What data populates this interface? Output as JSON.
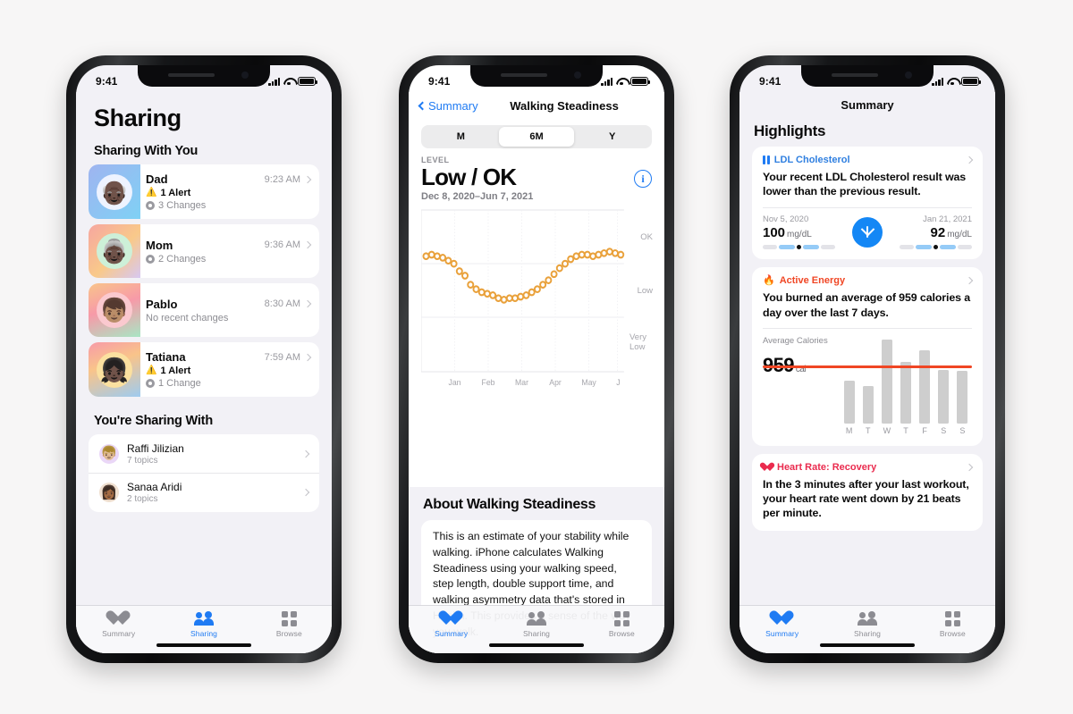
{
  "background_color": "#f7f6f6",
  "accent_blue": "#1f7bf3",
  "phones": {
    "sharing": {
      "status": {
        "time": "9:41",
        "signal_icon": "cellular-bars-icon",
        "wifi_icon": "wifi-icon",
        "battery_icon": "battery-icon"
      },
      "title": "Sharing",
      "section_with_you": "Sharing With You",
      "people": [
        {
          "name": "Dad",
          "time": "9:23 AM",
          "alert": "1 Alert",
          "changes": "3 Changes",
          "emoji": "👴🏿",
          "g1": "#9fb4f0",
          "g2": "#7fd1f5",
          "ring": "#eef3ff"
        },
        {
          "name": "Mom",
          "time": "9:36 AM",
          "alert": "",
          "changes": "2 Changes",
          "emoji": "👵🏿",
          "g1": "#f6a6a0",
          "g2": "#f9c98a",
          "ring": "#cdf0d8"
        },
        {
          "name": "Pablo",
          "time": "8:30 AM",
          "alert": "",
          "changes": "No recent changes",
          "emoji": "👦🏽",
          "g1": "#f9c48a",
          "g2": "#a8e6c4",
          "ring": "#fbc9cf"
        },
        {
          "name": "Tatiana",
          "time": "7:59 AM",
          "alert": "1 Alert",
          "changes": "1 Change",
          "emoji": "👧🏿",
          "g1": "#f79aa8",
          "g2": "#9ecbf0",
          "ring": "#fbe0a0"
        }
      ],
      "section_you_share": "You're Sharing With",
      "contacts": [
        {
          "name": "Raffi Jilizian",
          "topics": "7 topics",
          "emoji": "👦🏼",
          "bg": "#ead7f7"
        },
        {
          "name": "Sanaa Aridi",
          "topics": "2 topics",
          "emoji": "👩🏾",
          "bg": "#f0e0d0"
        }
      ],
      "tabs": [
        {
          "label": "Summary",
          "icon": "heart-icon",
          "active": false
        },
        {
          "label": "Sharing",
          "icon": "people-icon",
          "active": true
        },
        {
          "label": "Browse",
          "icon": "grid-icon",
          "active": false
        }
      ]
    },
    "walking": {
      "status": {
        "time": "9:41"
      },
      "back_label": "Summary",
      "nav_title": "Walking Steadiness",
      "segments": [
        {
          "label": "M",
          "selected": false
        },
        {
          "label": "6M",
          "selected": true
        },
        {
          "label": "Y",
          "selected": false
        }
      ],
      "level_label": "LEVEL",
      "level_value": "Low / OK",
      "date_range": "Dec 8, 2020–Jun 7, 2021",
      "info_icon": "info-circle-icon",
      "about_heading": "About Walking Steadiness",
      "about_text": "This is an estimate of your stability while walking. iPhone calculates Walking Steadiness using your walking speed, step length, double support time, and walking asymmetry data that's stored in Health. This provides a sense of the way you walk.",
      "tabs": [
        {
          "label": "Summary",
          "icon": "heart-icon",
          "active": true
        },
        {
          "label": "Sharing",
          "icon": "people-icon",
          "active": false
        },
        {
          "label": "Browse",
          "icon": "grid-icon",
          "active": false
        }
      ]
    },
    "summary": {
      "status": {
        "time": "9:41"
      },
      "nav_title": "Summary",
      "highlights_heading": "Highlights",
      "cards": {
        "ldl": {
          "category": "LDL Cholesterol",
          "category_color": "#2f7fe0",
          "icon": "ldl-bars-icon",
          "body": "Your recent LDL Cholesterol result was lower than the previous result.",
          "left_date": "Nov 5, 2020",
          "left_value": "100",
          "left_unit": "mg/dL",
          "right_date": "Jan 21, 2021",
          "right_value": "92",
          "right_unit": "mg/dL",
          "arrow_icon": "arrow-down-icon",
          "arrow_color": "#1487f5"
        },
        "active_energy": {
          "category": "Active Energy",
          "category_color": "#f04624",
          "icon": "flame-icon",
          "body": "You burned an average of 959 calories a day over the last 7 days.",
          "chart_caption": "Average Calories",
          "big_value": "959",
          "big_unit": "cal"
        },
        "heart": {
          "category": "Heart Rate: Recovery",
          "category_color": "#ea2b4e",
          "icon": "heart-icon",
          "body": "In the 3 minutes after your last workout, your heart rate went down by 21 beats per minute."
        }
      },
      "tabs": [
        {
          "label": "Summary",
          "icon": "heart-icon",
          "active": true
        },
        {
          "label": "Sharing",
          "icon": "people-icon",
          "active": false
        },
        {
          "label": "Browse",
          "icon": "grid-icon",
          "active": false
        }
      ]
    }
  },
  "chart_data": [
    {
      "id": "walking-steadiness",
      "type": "scatter",
      "title": "Walking Steadiness",
      "subtitle": "Low / OK",
      "date_range": "Dec 8, 2020–Jun 7, 2021",
      "xlabel": "",
      "ylabel": "",
      "grid": true,
      "legend": "none",
      "marker_color": "#e9a13b",
      "marker_fill": "#ffffff",
      "x_tick_labels": [
        "Jan",
        "Feb",
        "Mar",
        "Apr",
        "May",
        "J"
      ],
      "y_tick_labels": [
        "OK",
        "Low",
        "Very Low"
      ],
      "ylim": [
        0,
        100
      ],
      "y_gridline_values": [
        78,
        57,
        30
      ],
      "x": [
        0,
        1,
        2,
        3,
        4,
        5,
        6,
        7,
        8,
        9,
        10,
        11,
        12,
        13,
        14,
        15,
        16,
        17,
        18,
        19,
        20,
        21,
        22,
        23,
        24,
        25,
        26,
        27,
        28,
        29,
        30,
        31,
        32,
        33,
        34,
        35
      ],
      "values": [
        74,
        75,
        74,
        73,
        71,
        69,
        64,
        61,
        55,
        52,
        50,
        49,
        48,
        46,
        45,
        46,
        46,
        47,
        48,
        50,
        52,
        55,
        58,
        62,
        66,
        69,
        72,
        74,
        75,
        75,
        74,
        75,
        76,
        77,
        76,
        75
      ]
    },
    {
      "id": "active-energy",
      "type": "bar",
      "title": "Average Calories",
      "categories": [
        "M",
        "T",
        "W",
        "T",
        "F",
        "S",
        "S"
      ],
      "values": [
        700,
        620,
        1390,
        1020,
        1210,
        880,
        870
      ],
      "average_line": 959,
      "average_label": "959",
      "unit": "cal",
      "bar_color": "#cecece",
      "average_line_color": "#f04624",
      "xlabel": "",
      "ylabel": "",
      "ylim": [
        0,
        1450
      ],
      "grid": false,
      "legend": "none"
    }
  ]
}
